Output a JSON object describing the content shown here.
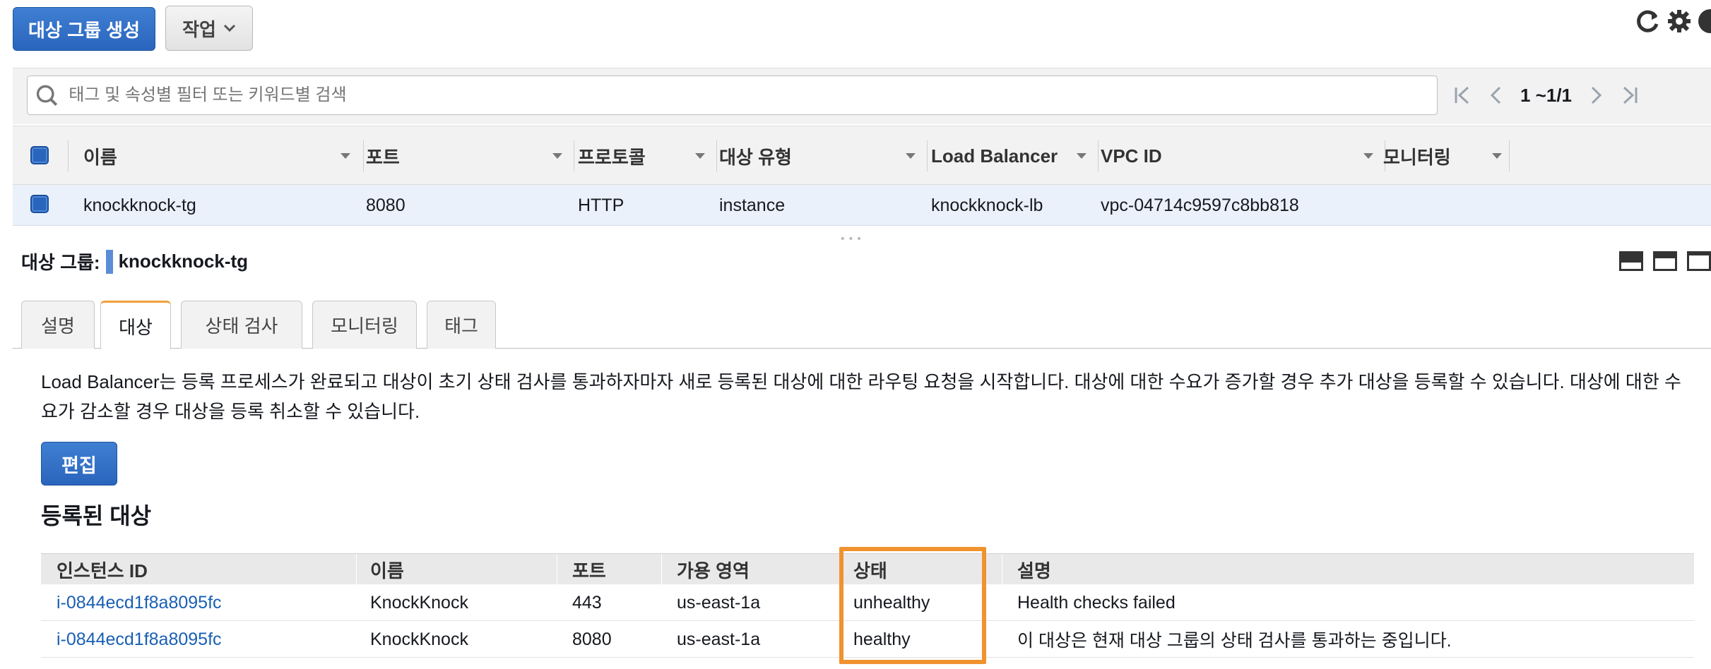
{
  "toolbar": {
    "create_label": "대상 그룹 생성",
    "actions_label": "작업"
  },
  "search": {
    "placeholder": "태그 및 속성별 필터 또는 키워드별 검색"
  },
  "pagination": {
    "count": "1 ~1/1"
  },
  "table": {
    "headers": [
      "이름",
      "포트",
      "프로토콜",
      "대상 유형",
      "Load Balancer",
      "VPC ID",
      "모니터링"
    ],
    "rows": [
      {
        "name": "knockknock-tg",
        "port": "8080",
        "protocol": "HTTP",
        "target_type": "instance",
        "load_balancer": "knockknock-lb",
        "vpc_id": "vpc-04714c9597c8bb818",
        "monitoring": ""
      }
    ]
  },
  "detail": {
    "label": "대상 그룹:",
    "name": "knockknock-tg",
    "tabs": [
      "설명",
      "대상",
      "상태 검사",
      "모니터링",
      "태그"
    ],
    "active_tab": "대상",
    "description": "Load Balancer는 등록 프로세스가 완료되고 대상이 초기 상태 검사를 통과하자마자 새로 등록된 대상에 대한 라우팅 요청을 시작합니다. 대상에 대한 수요가 증가할 경우 추가 대상을 등록할 수 있습니다. 대상에 대한 수요가 감소할 경우 대상을 등록 취소할 수 있습니다.",
    "edit_label": "편집",
    "section_title": "등록된 대상"
  },
  "targets": {
    "headers": [
      "인스턴스 ID",
      "이름",
      "포트",
      "가용 영역",
      "상태",
      "설명"
    ],
    "rows": [
      {
        "instance_id": "i-0844ecd1f8a8095fc",
        "name": "KnockKnock",
        "port": "443",
        "zone": "us-east-1a",
        "status": "unhealthy",
        "description": "Health checks failed"
      },
      {
        "instance_id": "i-0844ecd1f8a8095fc",
        "name": "KnockKnock",
        "port": "8080",
        "zone": "us-east-1a",
        "status": "healthy",
        "description": "이 대상은 현재 대상 그룹의 상태 검사를 통과하는 중입니다."
      }
    ]
  },
  "colors": {
    "primary": "#2a65bd",
    "link": "#1a5fb4",
    "tab_accent": "#f0a03a",
    "highlight": "#f0922e",
    "selected_row": "#eaf1fb"
  }
}
